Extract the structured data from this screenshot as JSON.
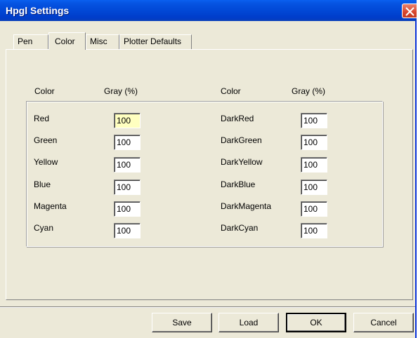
{
  "window": {
    "title": "Hpgl Settings"
  },
  "tabs": [
    {
      "label": "Pen"
    },
    {
      "label": "Color"
    },
    {
      "label": "Misc"
    },
    {
      "label": "Plotter Defaults"
    }
  ],
  "selected_tab": "Color",
  "headers": {
    "color": "Color",
    "gray": "Gray (%)"
  },
  "left_colors": [
    {
      "name": "Red",
      "gray": "100"
    },
    {
      "name": "Green",
      "gray": "100"
    },
    {
      "name": "Yellow",
      "gray": "100"
    },
    {
      "name": "Blue",
      "gray": "100"
    },
    {
      "name": "Magenta",
      "gray": "100"
    },
    {
      "name": "Cyan",
      "gray": "100"
    }
  ],
  "right_colors": [
    {
      "name": "DarkRed",
      "gray": "100"
    },
    {
      "name": "DarkGreen",
      "gray": "100"
    },
    {
      "name": "DarkYellow",
      "gray": "100"
    },
    {
      "name": "DarkBlue",
      "gray": "100"
    },
    {
      "name": "DarkMagenta",
      "gray": "100"
    },
    {
      "name": "DarkCyan",
      "gray": "100"
    }
  ],
  "buttons": {
    "save": "Save",
    "load": "Load",
    "ok": "OK",
    "cancel": "Cancel"
  },
  "colors": {
    "titlebar": "#0148D6",
    "face": "#ECE9D8",
    "focus_field": "#FFFFC0"
  }
}
